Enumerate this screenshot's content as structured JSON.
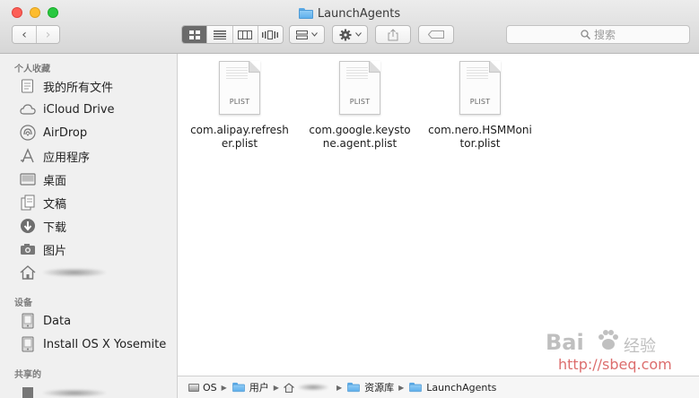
{
  "window": {
    "title": "LaunchAgents"
  },
  "toolbar": {
    "back_symbol": "‹",
    "forward_symbol": "›",
    "view_modes": [
      "icon-view",
      "list-view",
      "column-view",
      "coverflow-view"
    ],
    "search_placeholder": "搜索"
  },
  "sidebar": {
    "favorites_heading": "个人收藏",
    "favorites": [
      {
        "label": "我的所有文件",
        "icon": "all-files-icon"
      },
      {
        "label": "iCloud Drive",
        "icon": "cloud-icon"
      },
      {
        "label": "AirDrop",
        "icon": "airdrop-icon"
      },
      {
        "label": "应用程序",
        "icon": "applications-icon"
      },
      {
        "label": "桌面",
        "icon": "desktop-icon"
      },
      {
        "label": "文稿",
        "icon": "documents-icon"
      },
      {
        "label": "下载",
        "icon": "downloads-icon"
      },
      {
        "label": "图片",
        "icon": "pictures-icon"
      },
      {
        "label": "",
        "icon": "home-icon"
      }
    ],
    "devices_heading": "设备",
    "devices": [
      {
        "label": "Data",
        "icon": "disk-icon"
      },
      {
        "label": "Install OS X Yosemite",
        "icon": "disk-icon"
      }
    ],
    "shared_heading": "共享的"
  },
  "files": [
    {
      "name": "com.alipay.refresher.plist",
      "ext": "PLIST"
    },
    {
      "name": "com.google.keystone.agent.plist",
      "ext": "PLIST"
    },
    {
      "name": "com.nero.HSMMonitor.plist",
      "ext": "PLIST"
    }
  ],
  "pathbar": {
    "items": [
      "OS",
      "用户",
      "",
      "资源库",
      "LaunchAgents"
    ]
  },
  "watermark": {
    "logo": "Bai",
    "brand": "经验",
    "url": "http://sbeq.com"
  },
  "colors": {
    "close": "#fc5f57",
    "minimize": "#fdbc2e",
    "maximize": "#28c840",
    "sidebar_bg": "#f0f0f0",
    "folder": "#5fb0ec"
  }
}
